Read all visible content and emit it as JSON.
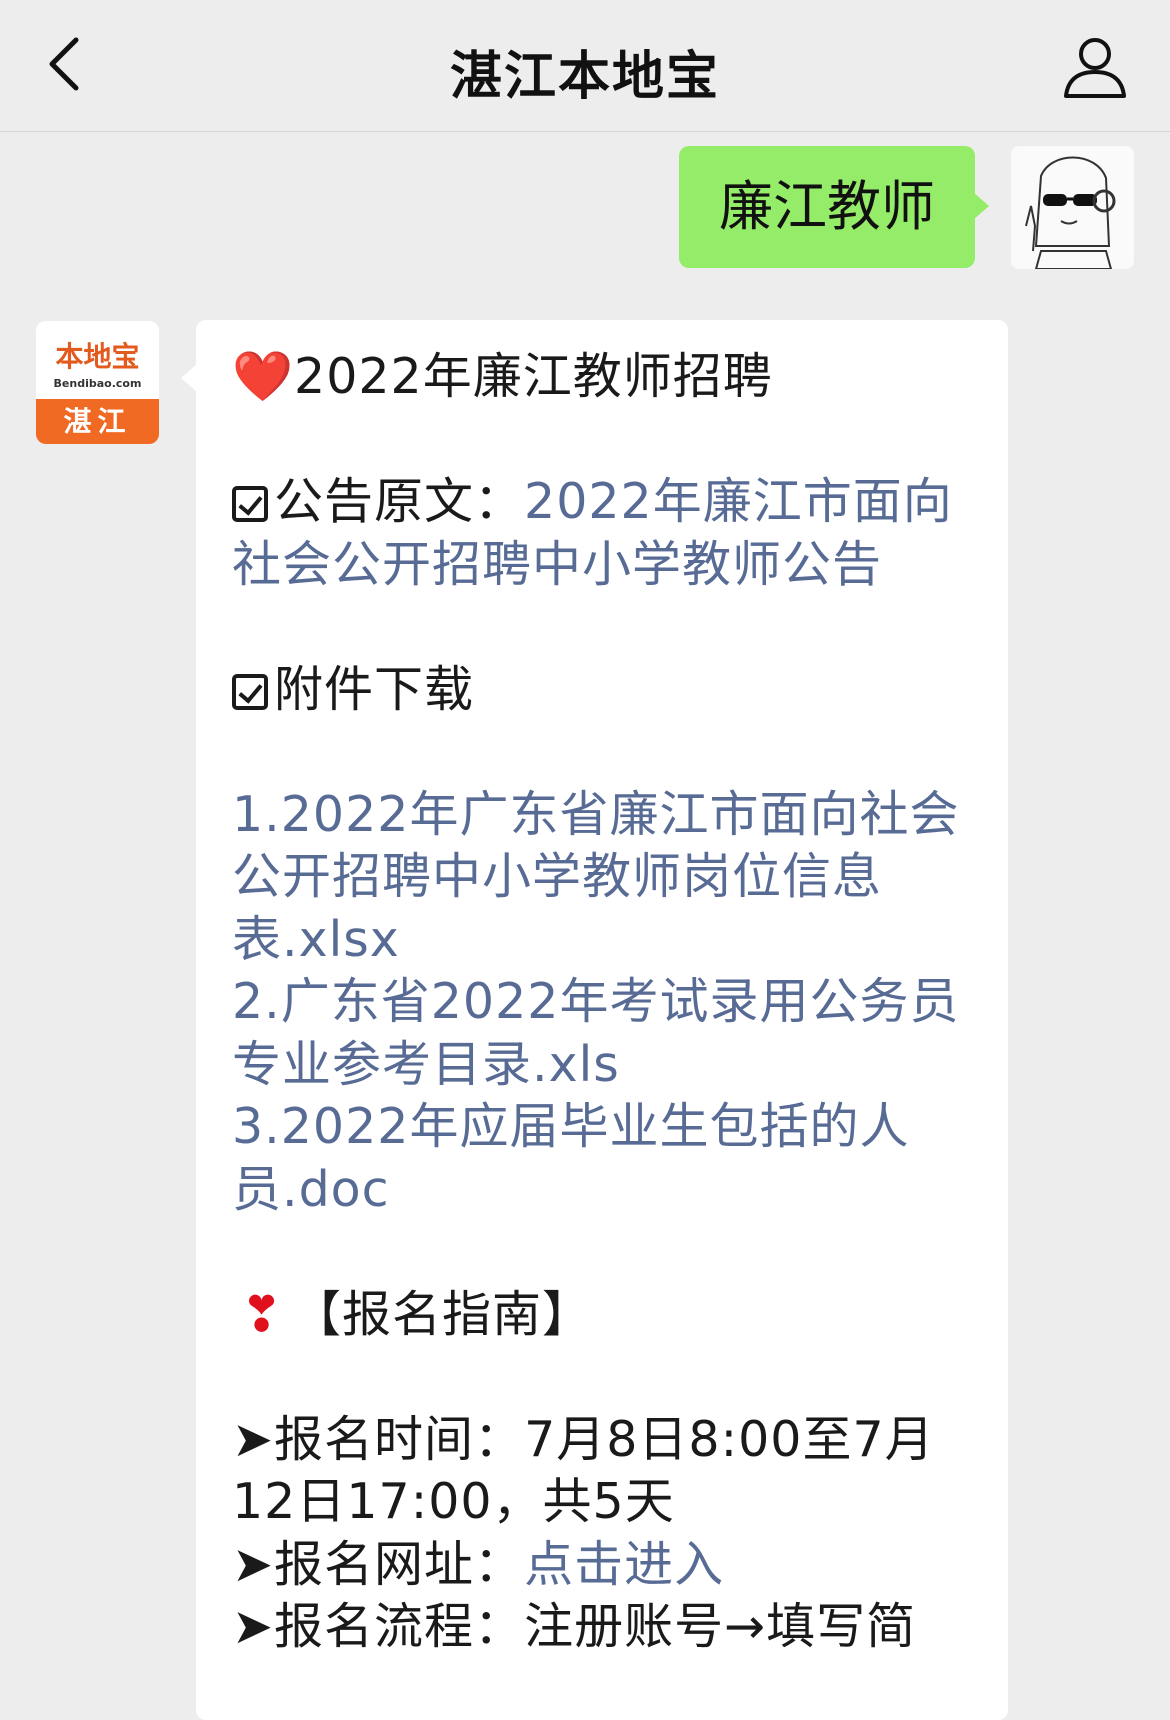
{
  "navbar": {
    "title": "湛江本地宝",
    "back_icon": "chevron-left-icon",
    "profile_icon": "user-icon"
  },
  "user_message": {
    "text": "廉江教师"
  },
  "bot_avatar": {
    "brand": "本地宝",
    "domain": "Bendibao.com",
    "city": "湛江"
  },
  "bot_message": {
    "title_icon": "❤️",
    "title": "2022年廉江教师招聘",
    "notice_label": "公告原文：",
    "notice_link": "2022年廉江市面向社会公开招聘中小学教师公告",
    "attach_label": "附件下载",
    "attachments": [
      "1.2022年广东省廉江市面向社会公开招聘中小学教师岗位信息表.xlsx",
      "2.广东省2022年考试录用公务员专业参考目录.xls",
      "3.2022年应届毕业生包括的人员.doc"
    ],
    "guide_title": "【报名指南】",
    "guide_icon": "❣",
    "time_label": "➤报名时间：",
    "time_value": "7月8日8:00至7月12日17:00，共5天",
    "site_label": "➤报名网址：",
    "site_link": "点击进入",
    "flow_label": "➤报名流程：",
    "flow_value": "注册账号→填写简"
  },
  "colors": {
    "background": "#ededed",
    "bubble_out": "#95ec69",
    "bubble_in": "#ffffff",
    "link": "#576b95",
    "heart": "#e0101d",
    "brand_orange": "#f06a24"
  }
}
